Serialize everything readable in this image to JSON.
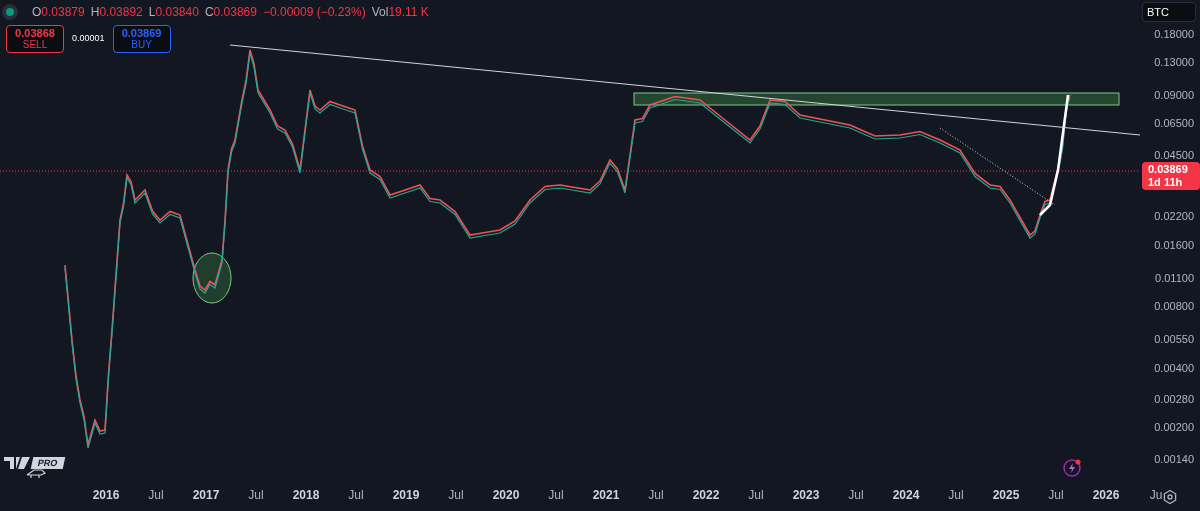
{
  "legend": {
    "values": [
      {
        "label": "O",
        "value": "0.03879"
      },
      {
        "label": "H",
        "value": "0.03892"
      },
      {
        "label": "L",
        "value": "0.03840"
      },
      {
        "label": "C",
        "value": "0.03869"
      }
    ],
    "change": "−0.00009 (−0.23%)",
    "volume_label": "Vol",
    "volume": "19.11 K"
  },
  "trade": {
    "sell": {
      "price": "0.03868",
      "label": "SELL"
    },
    "spread": "0.00001",
    "buy": {
      "price": "0.03869",
      "label": "BUY"
    }
  },
  "currency": "BTC",
  "price_tag": {
    "price": "0.03869",
    "countdown": "1d 11h"
  },
  "price_axis": [
    "0.18000",
    "0.13000",
    "0.09000",
    "0.06500",
    "0.04500",
    "0.02200",
    "0.01600",
    "0.01100",
    "0.00800",
    "0.00550",
    "0.00400",
    "0.00280",
    "0.00200",
    "0.00140"
  ],
  "time_axis": [
    {
      "label": "2016",
      "kind": "year"
    },
    {
      "label": "Jul",
      "kind": "month"
    },
    {
      "label": "2017",
      "kind": "year"
    },
    {
      "label": "Jul",
      "kind": "month"
    },
    {
      "label": "2018",
      "kind": "year"
    },
    {
      "label": "Jul",
      "kind": "month"
    },
    {
      "label": "2019",
      "kind": "year"
    },
    {
      "label": "Jul",
      "kind": "month"
    },
    {
      "label": "2020",
      "kind": "year"
    },
    {
      "label": "Jul",
      "kind": "month"
    },
    {
      "label": "2021",
      "kind": "year"
    },
    {
      "label": "Jul",
      "kind": "month"
    },
    {
      "label": "2022",
      "kind": "year"
    },
    {
      "label": "Jul",
      "kind": "month"
    },
    {
      "label": "2023",
      "kind": "year"
    },
    {
      "label": "Jul",
      "kind": "month"
    },
    {
      "label": "2024",
      "kind": "year"
    },
    {
      "label": "Jul",
      "kind": "month"
    },
    {
      "label": "2025",
      "kind": "year"
    },
    {
      "label": "Jul",
      "kind": "month"
    },
    {
      "label": "2026",
      "kind": "year"
    },
    {
      "label": "Ju",
      "kind": "month"
    }
  ],
  "logo": {
    "badge": "PRO"
  }
}
